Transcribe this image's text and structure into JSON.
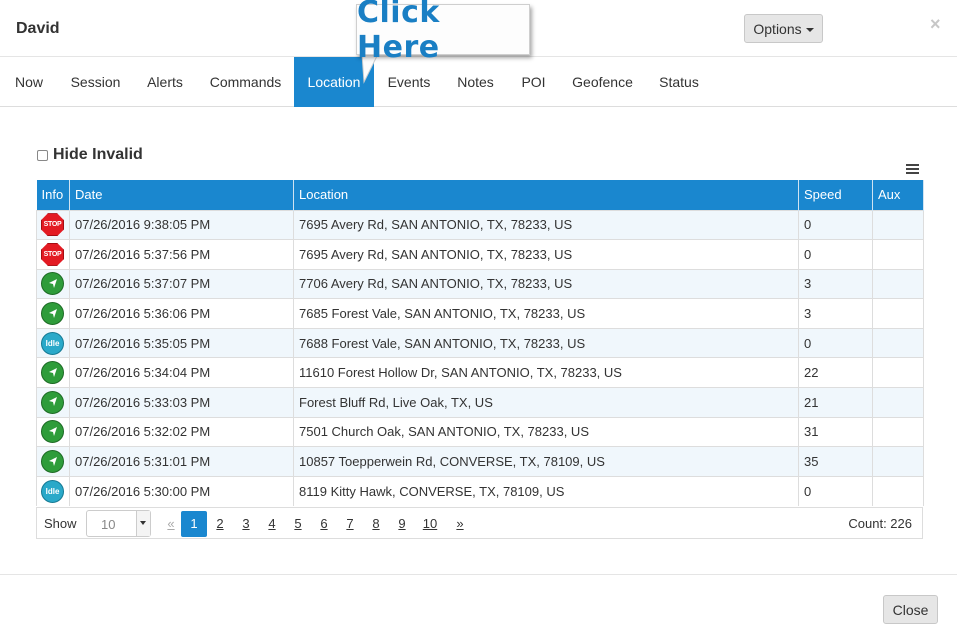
{
  "header": {
    "title": "David",
    "options_label": "Options",
    "close_symbol": "×"
  },
  "callout": {
    "text": "Click Here"
  },
  "tabs": [
    {
      "label": "Now"
    },
    {
      "label": "Session"
    },
    {
      "label": "Alerts"
    },
    {
      "label": "Commands"
    },
    {
      "label": "Location",
      "active": true
    },
    {
      "label": "Events"
    },
    {
      "label": "Notes"
    },
    {
      "label": "POI"
    },
    {
      "label": "Geofence"
    },
    {
      "label": "Status"
    }
  ],
  "filter": {
    "hide_invalid_label": "Hide Invalid",
    "checked": false
  },
  "table": {
    "columns": [
      "Info",
      "Date",
      "Location",
      "Speed",
      "Aux"
    ],
    "rows": [
      {
        "icon": "stop-icon",
        "icon_text": "STOP",
        "date": "07/26/2016 9:38:05 PM",
        "location": "7695 Avery Rd, SAN ANTONIO, TX, 78233, US",
        "speed": "0",
        "aux": ""
      },
      {
        "icon": "stop-icon",
        "icon_text": "STOP",
        "date": "07/26/2016 5:37:56 PM",
        "location": "7695 Avery Rd, SAN ANTONIO, TX, 78233, US",
        "speed": "0",
        "aux": ""
      },
      {
        "icon": "moving-arrow-icon",
        "icon_text": "",
        "date": "07/26/2016 5:37:07 PM",
        "location": "7706 Avery Rd, SAN ANTONIO, TX, 78233, US",
        "speed": "3",
        "aux": ""
      },
      {
        "icon": "moving-arrow-icon",
        "icon_text": "",
        "date": "07/26/2016 5:36:06 PM",
        "location": "7685 Forest Vale, SAN ANTONIO, TX, 78233, US",
        "speed": "3",
        "aux": ""
      },
      {
        "icon": "idle-icon",
        "icon_text": "Idle",
        "date": "07/26/2016 5:35:05 PM",
        "location": "7688 Forest Vale, SAN ANTONIO, TX, 78233, US",
        "speed": "0",
        "aux": ""
      },
      {
        "icon": "moving-arrow-icon",
        "icon_text": "",
        "date": "07/26/2016 5:34:04 PM",
        "location": "11610 Forest Hollow Dr, SAN ANTONIO, TX, 78233, US",
        "speed": "22",
        "aux": ""
      },
      {
        "icon": "moving-arrow-icon",
        "icon_text": "",
        "date": "07/26/2016 5:33:03 PM",
        "location": "Forest Bluff Rd, Live Oak, TX, US",
        "speed": "21",
        "aux": ""
      },
      {
        "icon": "moving-arrow-icon",
        "icon_text": "",
        "date": "07/26/2016 5:32:02 PM",
        "location": "7501 Church Oak, SAN ANTONIO, TX, 78233, US",
        "speed": "31",
        "aux": ""
      },
      {
        "icon": "moving-arrow-icon",
        "icon_text": "",
        "date": "07/26/2016 5:31:01 PM",
        "location": "10857 Toepperwein Rd, CONVERSE, TX, 78109, US",
        "speed": "35",
        "aux": ""
      },
      {
        "icon": "idle-icon",
        "icon_text": "Idle",
        "date": "07/26/2016 5:30:00 PM",
        "location": "8119 Kitty Hawk, CONVERSE, TX, 78109, US",
        "speed": "0",
        "aux": ""
      }
    ]
  },
  "pagination": {
    "show_label": "Show",
    "page_size": "10",
    "prev": "«",
    "pages": [
      "1",
      "2",
      "3",
      "4",
      "5",
      "6",
      "7",
      "8",
      "9",
      "10"
    ],
    "current_page": "1",
    "next": "»",
    "count_label": "Count: 226"
  },
  "footer": {
    "close_label": "Close"
  },
  "colors": {
    "accent": "#1a87cf",
    "stop": "#e31b23",
    "moving": "#2e9c3a",
    "idle": "#2aa9c9"
  }
}
